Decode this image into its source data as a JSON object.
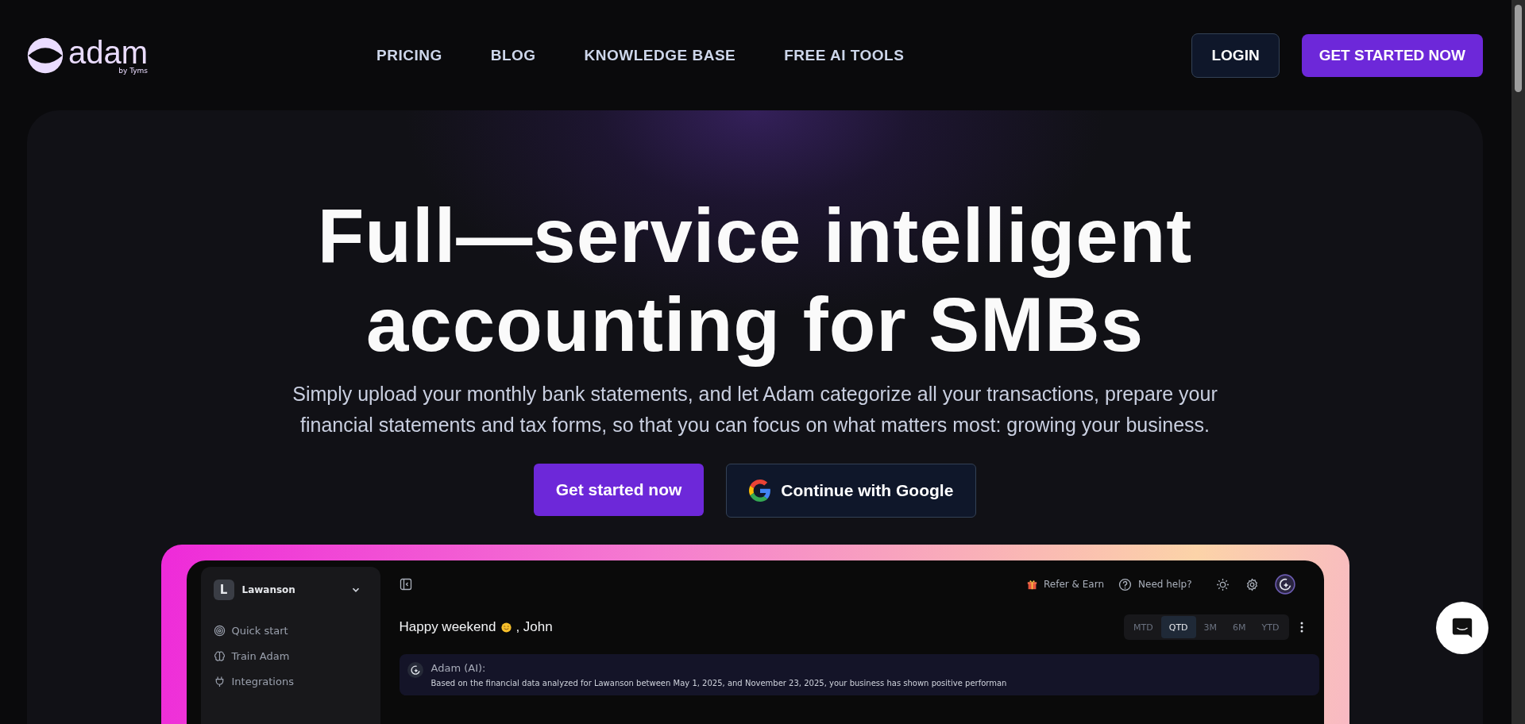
{
  "logo": {
    "name": "adam",
    "tagline": "by Tyms"
  },
  "nav": {
    "links": [
      "PRICING",
      "BLOG",
      "KNOWLEDGE BASE",
      "FREE AI TOOLS"
    ],
    "login": "LOGIN",
    "cta": "GET STARTED NOW"
  },
  "hero": {
    "title_lines": [
      "Full—service intelligent",
      "accounting for SMBs"
    ],
    "subtitle": "Simply upload your monthly bank statements, and let Adam categorize all your transactions, prepare your financial statements and tax forms, so that you can focus on what matters most: growing your business.",
    "primary_button": "Get started now",
    "google_button": "Continue with Google"
  },
  "preview": {
    "workspace": {
      "initial": "L",
      "name": "Lawanson"
    },
    "sidebar_items": [
      {
        "kind": "target",
        "label": "Quick start"
      },
      {
        "kind": "brain",
        "label": "Train Adam"
      },
      {
        "kind": "plug",
        "label": "Integrations"
      }
    ],
    "topbar": {
      "refer": "Refer & Earn",
      "help": "Need help?"
    },
    "greeting_start": "Happy weekend",
    "greeting_end": ", John",
    "periods": [
      {
        "label": "MTD",
        "selected": false
      },
      {
        "label": "QTD",
        "selected": true
      },
      {
        "label": "3M",
        "selected": false
      },
      {
        "label": "6M",
        "selected": false
      },
      {
        "label": "YTD",
        "selected": false
      }
    ],
    "message": {
      "author": "Adam (AI):",
      "text": "Based on the financial data analyzed for Lawanson between May 1, 2025, and November 23, 2025, your business has shown positive performan"
    }
  }
}
